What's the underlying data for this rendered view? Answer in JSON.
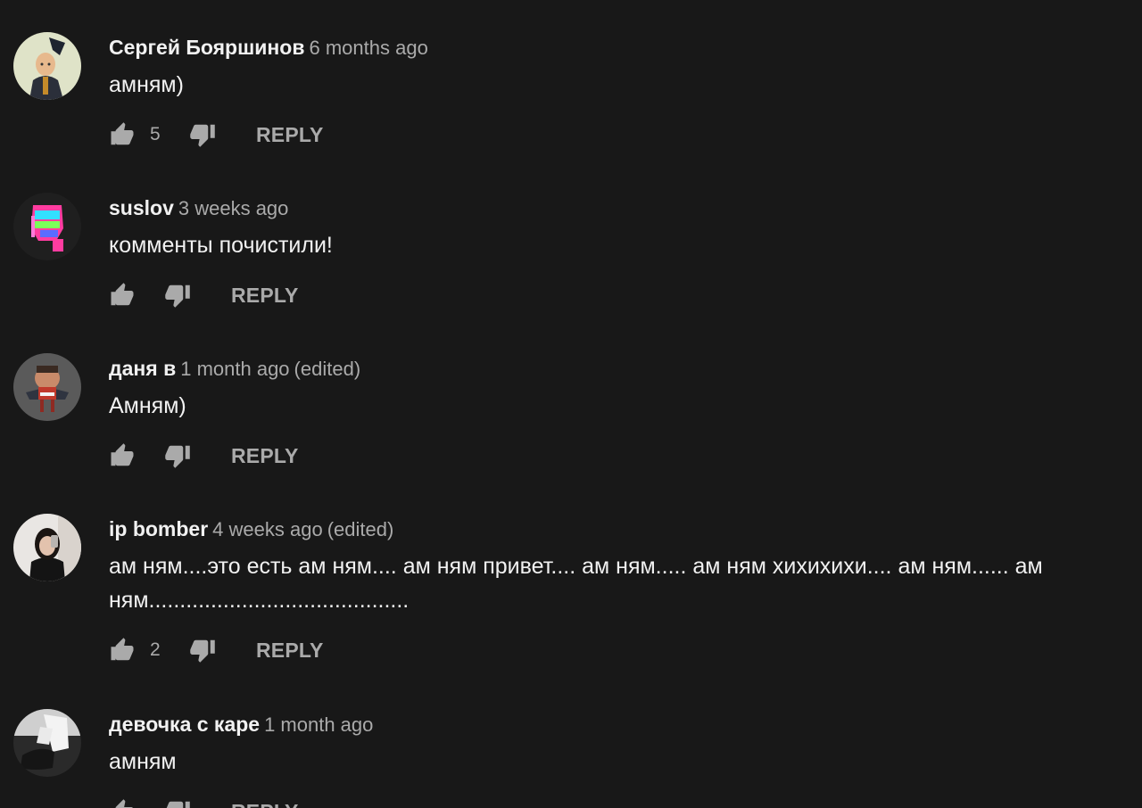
{
  "reply_label": "REPLY",
  "comments": [
    {
      "author": "Сергей Бояршинов",
      "time": "6 months ago",
      "edited": "",
      "text": "амням)",
      "likes": "5",
      "avatar": "avatar-bald-man-icon"
    },
    {
      "author": "suslov",
      "time": "3 weeks ago",
      "edited": "",
      "text": "комменты почистили!",
      "likes": "",
      "avatar": "avatar-glitch-skull-icon"
    },
    {
      "author": "даня в",
      "time": "1 month ago",
      "edited": "(edited)",
      "text": "Амням)",
      "likes": "",
      "avatar": "avatar-cartoon-character-icon"
    },
    {
      "author": "ip bomber",
      "time": "4 weeks ago",
      "edited": "(edited)",
      "text": "ам ням....это есть ам ням.... ам ням привет.... ам ням..... ам ням хихихихи.... ам ням...... ам ням..........................................",
      "likes": "2",
      "avatar": "avatar-girl-photo-icon"
    },
    {
      "author": "девочка с каре",
      "time": "1 month ago",
      "edited": "",
      "text": "амням",
      "likes": "",
      "avatar": "avatar-socks-photo-icon"
    }
  ],
  "colors": {
    "background": "#181818",
    "primary_text": "#f1f1f1",
    "secondary_text": "#aaaaaa"
  }
}
